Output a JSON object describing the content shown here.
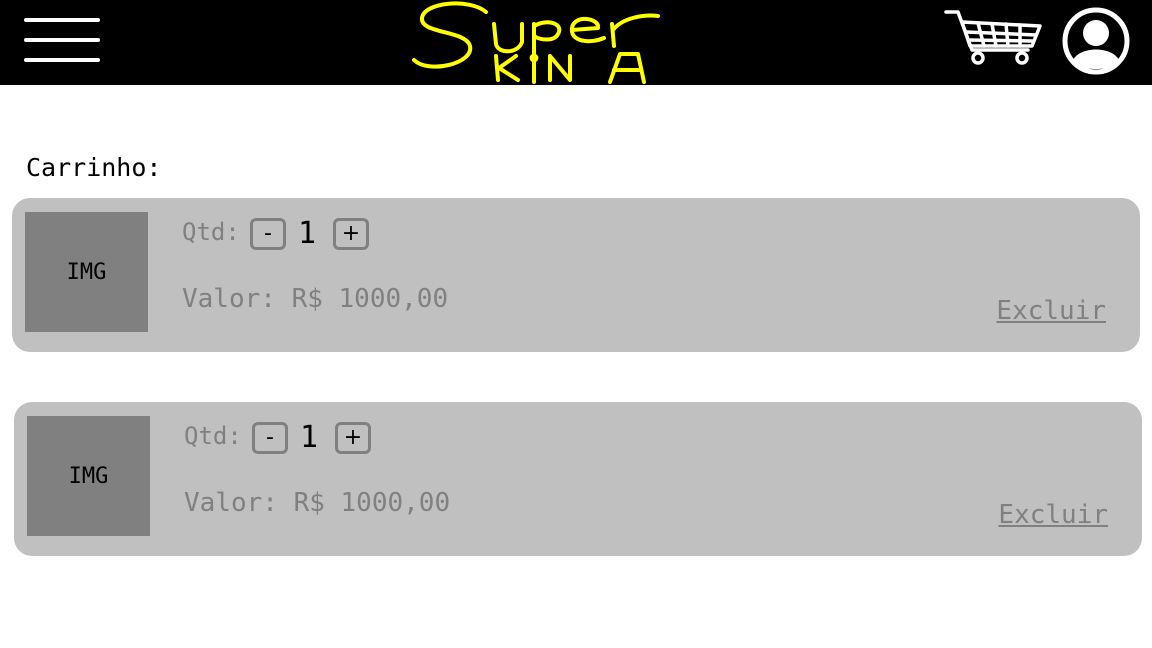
{
  "header": {
    "logo_text": "Super KiNA",
    "menu_icon": "hamburger-menu-icon",
    "cart_icon": "shopping-cart-icon",
    "user_icon": "user-profile-icon",
    "colors": {
      "bar": "#000000",
      "logo": "#ffff00",
      "icons": "#ffffff"
    }
  },
  "cart": {
    "title": "Carrinho:",
    "items": [
      {
        "image_label": "IMG",
        "qty_label": "Qtd:",
        "decrement_label": "-",
        "quantity": "1",
        "increment_label": "+",
        "price_text": "Valor: R$ 1000,00",
        "remove_label": "Excluir"
      },
      {
        "image_label": "IMG",
        "qty_label": "Qtd:",
        "decrement_label": "-",
        "quantity": "1",
        "increment_label": "+",
        "price_text": "Valor: R$ 1000,00",
        "remove_label": "Excluir"
      }
    ],
    "colors": {
      "card": "#c0c0c0",
      "thumb": "#808080",
      "muted_text": "#808080"
    }
  }
}
